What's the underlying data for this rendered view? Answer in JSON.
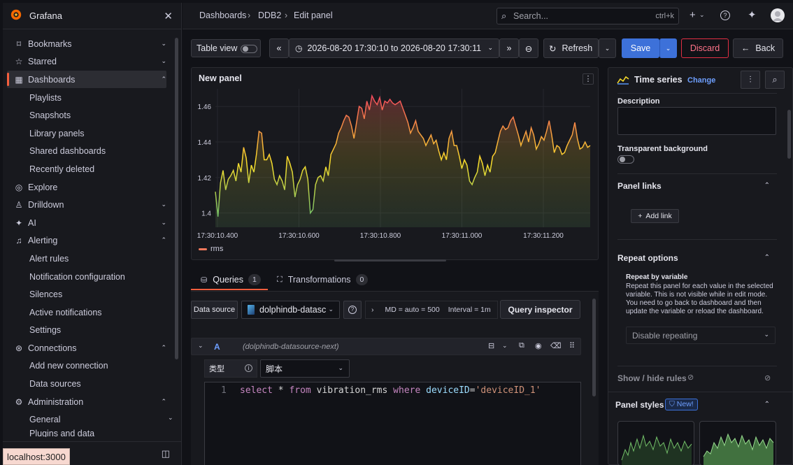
{
  "sidebar": {
    "app_name": "Grafana",
    "items": [
      {
        "label": "Bookmarks",
        "icon": "bookmark-icon"
      },
      {
        "label": "Starred",
        "icon": "star-icon"
      },
      {
        "label": "Dashboards",
        "icon": "dashboards-icon"
      },
      {
        "label": "Explore",
        "icon": "compass-icon"
      },
      {
        "label": "Drilldown",
        "icon": "drilldown-icon"
      },
      {
        "label": "AI",
        "icon": "sparkle-icon"
      },
      {
        "label": "Alerting",
        "icon": "bell-icon"
      },
      {
        "label": "Connections",
        "icon": "connections-icon"
      },
      {
        "label": "Administration",
        "icon": "gear-icon"
      }
    ],
    "dashboards_children": [
      "Playlists",
      "Snapshots",
      "Library panels",
      "Shared dashboards",
      "Recently deleted"
    ],
    "alerting_children": [
      "Alert rules",
      "Notification configuration",
      "Silences",
      "Active notifications",
      "Settings"
    ],
    "connections_children": [
      "Add new connection",
      "Data sources"
    ],
    "admin_children": [
      "General",
      "Plugins and data"
    ],
    "status_url": "localhost:3000"
  },
  "topbar": {
    "breadcrumbs": [
      "Dashboards",
      "DDB2",
      "Edit panel"
    ],
    "search_placeholder": "Search...",
    "search_shortcut": "ctrl+k"
  },
  "toolbar": {
    "table_view_label": "Table view",
    "time_range": "2026-08-20 17:30:10 to 2026-08-20 17:30:11",
    "refresh_label": "Refresh",
    "save_label": "Save",
    "discard_label": "Discard",
    "back_label": "Back"
  },
  "panel": {
    "title": "New panel",
    "legend": "rms"
  },
  "chart_data": {
    "type": "line",
    "x_ticks": [
      "17:30:10.400",
      "17:30:10.600",
      "17:30:10.800",
      "17:30:11.000",
      "17:30:11.200"
    ],
    "y_ticks": [
      "1.4",
      "1.42",
      "1.44",
      "1.46"
    ],
    "ylim": [
      1.392,
      1.466
    ],
    "series": [
      {
        "name": "rms",
        "values": [
          1.412,
          1.398,
          1.417,
          1.424,
          1.413,
          1.419,
          1.421,
          1.424,
          1.418,
          1.428,
          1.423,
          1.437,
          1.431,
          1.417,
          1.427,
          1.423,
          1.433,
          1.446,
          1.445,
          1.43,
          1.43,
          1.433,
          1.428,
          1.419,
          1.416,
          1.421,
          1.418,
          1.413,
          1.432,
          1.428,
          1.423,
          1.409,
          1.416,
          1.419,
          1.424,
          1.426,
          1.419,
          1.4,
          1.402,
          1.416,
          1.42,
          1.421,
          1.418,
          1.426,
          1.421,
          1.433,
          1.436,
          1.439,
          1.445,
          1.448,
          1.452,
          1.455,
          1.454,
          1.449,
          1.442,
          1.451,
          1.46,
          1.459,
          1.453,
          1.463,
          1.458,
          1.466,
          1.463,
          1.461,
          1.465,
          1.458,
          1.463,
          1.462,
          1.464,
          1.462,
          1.461,
          1.462,
          1.463,
          1.459,
          1.455,
          1.451,
          1.445,
          1.448,
          1.452,
          1.446,
          1.444,
          1.442,
          1.438,
          1.441,
          1.444,
          1.439,
          1.441,
          1.435,
          1.43,
          1.434,
          1.43,
          1.442,
          1.446,
          1.438,
          1.438,
          1.432,
          1.425,
          1.43,
          1.427,
          1.418,
          1.416,
          1.42,
          1.423,
          1.432,
          1.428,
          1.421,
          1.427,
          1.423,
          1.432,
          1.434,
          1.44,
          1.446,
          1.449,
          1.447,
          1.448,
          1.452,
          1.454,
          1.449,
          1.444,
          1.438,
          1.442,
          1.446,
          1.44,
          1.448,
          1.444,
          1.436,
          1.439,
          1.443,
          1.441,
          1.446,
          1.452,
          1.444,
          1.434,
          1.438,
          1.437,
          1.433,
          1.434,
          1.438,
          1.441,
          1.444,
          1.451,
          1.442,
          1.436,
          1.437,
          1.44,
          1.437,
          1.438
        ]
      }
    ]
  },
  "query": {
    "tabs": [
      {
        "label": "Queries",
        "count": "1"
      },
      {
        "label": "Transformations",
        "count": "0"
      }
    ],
    "datasource_label": "Data source",
    "datasource_value": "dolphindb-datasc",
    "options": "MD = auto = 500",
    "interval": "Interval = 1m",
    "inspector_label": "Query inspector",
    "row_letter": "A",
    "row_source": "(dolphindb-datasource-next)",
    "type_label": "类型",
    "type_value": "脚本",
    "line_no": "1",
    "code": {
      "kw1": "select",
      "star": " * ",
      "kw2": "from",
      "table": " vibration_rms ",
      "kw3": "where",
      "field": " deviceID",
      "eq": "=",
      "str": "'deviceID_1'"
    }
  },
  "options": {
    "viz_name": "Time series",
    "change_label": "Change",
    "description_label": "Description",
    "transparent_label": "Transparent background",
    "panel_links_label": "Panel links",
    "add_link_label": "Add link",
    "repeat_options_label": "Repeat options",
    "repeat_by_label": "Repeat by variable",
    "repeat_help": "Repeat this panel for each value in the selected variable. This is not visible while in edit mode. You need to go back to dashboard and then update the variable or reload the dashboard.",
    "repeat_select": "Disable repeating",
    "show_hide_rules": "Show / hide rules",
    "panel_styles_label": "Panel styles",
    "new_badge": "New!"
  },
  "colors": {
    "accent": "#f55f3e",
    "primary": "#3d71d9",
    "danger": "#e02f44"
  }
}
